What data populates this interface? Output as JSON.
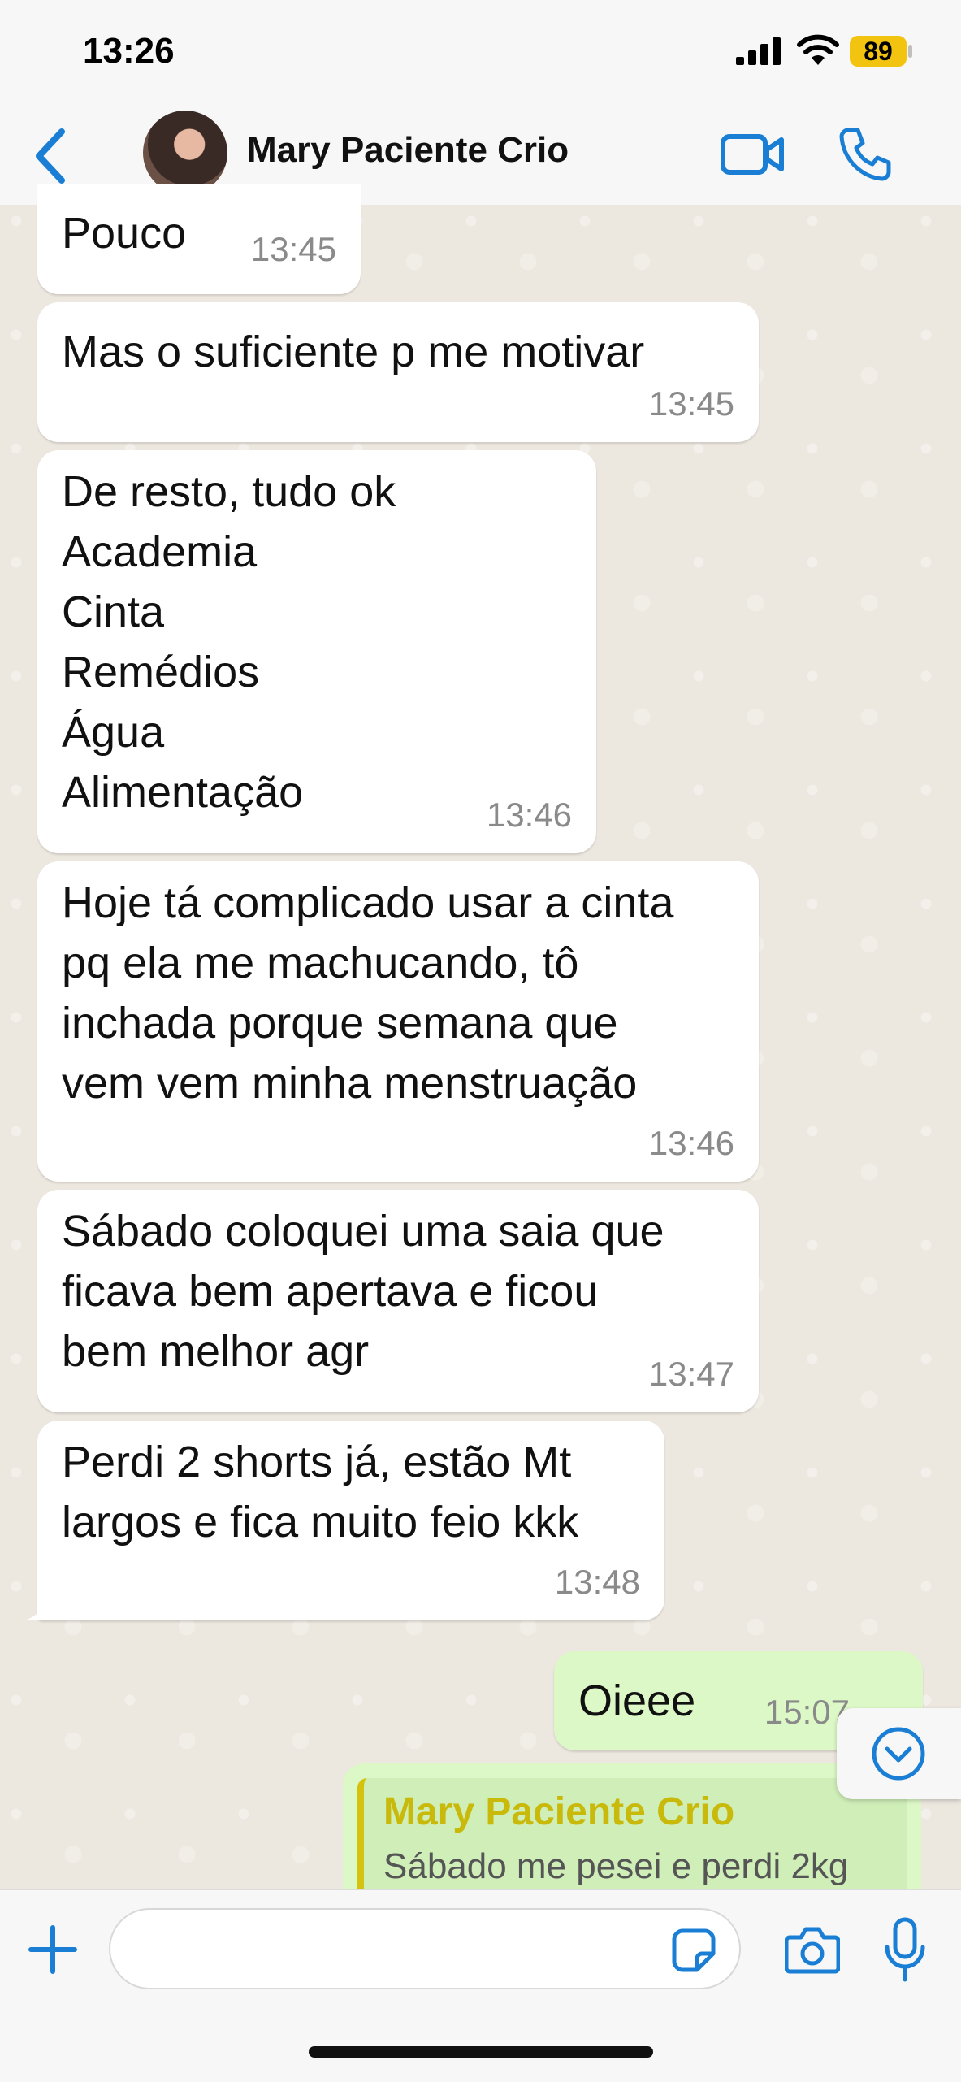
{
  "status_bar": {
    "time": "13:26",
    "battery": "89"
  },
  "header": {
    "contact_name": "Mary Paciente Crio"
  },
  "messages": [
    {
      "text": "Pouco",
      "time": "13:45"
    },
    {
      "text": "Mas o suficiente p me motivar",
      "time": "13:45"
    },
    {
      "text": "De resto, tudo ok\nAcademia\nCinta\nRemédios\nÁgua\nAlimentação",
      "time": "13:46"
    },
    {
      "text": "Hoje tá complicado usar a cinta\npq ela me machucando, tô\ninchada porque semana que\nvem vem minha menstruação",
      "time": "13:46"
    },
    {
      "text": "Sábado coloquei uma saia que\nficava bem apertava e ficou\nbem melhor agr",
      "time": "13:47"
    },
    {
      "text": "Perdi 2 shorts já, estão Mt\nlargos e fica muito feio kkk",
      "time": "13:48"
    },
    {
      "text": "Oieee",
      "time": "15:07"
    }
  ],
  "quoted_reply": {
    "name": "Mary Paciente Crio",
    "text": "Sábado me pesei e perdi 2kg"
  },
  "composer": {
    "placeholder": ""
  },
  "colors": {
    "accent": "#1a7fd4",
    "outgoing": "#dcf8c6",
    "incoming": "#ffffff",
    "quote_name": "#c9b90a"
  }
}
